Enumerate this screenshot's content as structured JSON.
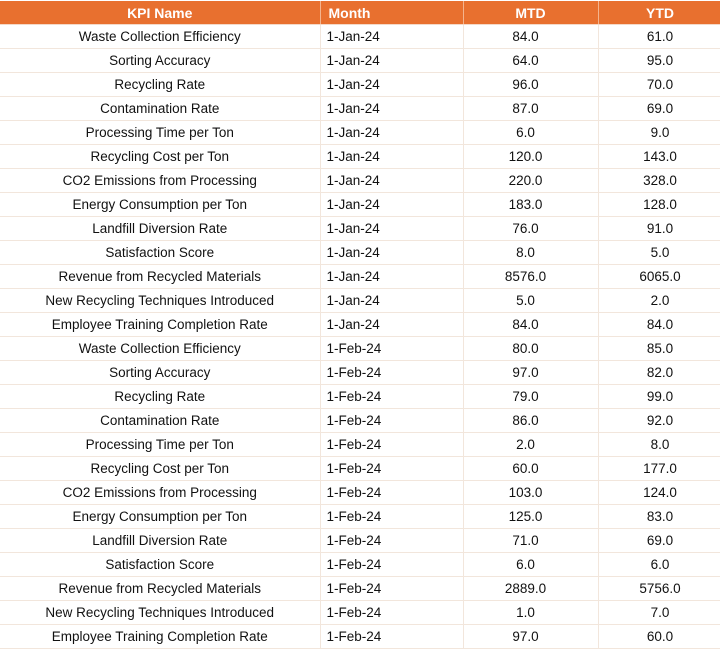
{
  "header": {
    "kpi": "KPI Name",
    "month": "Month",
    "mtd": "MTD",
    "ytd": "YTD"
  },
  "colors": {
    "header_bg": "#E8702F",
    "header_text": "#FFFFFF"
  },
  "rows": [
    {
      "kpi": "Waste Collection Efficiency",
      "month": "1-Jan-24",
      "mtd": "84.0",
      "ytd": "61.0"
    },
    {
      "kpi": "Sorting Accuracy",
      "month": "1-Jan-24",
      "mtd": "64.0",
      "ytd": "95.0"
    },
    {
      "kpi": "Recycling Rate",
      "month": "1-Jan-24",
      "mtd": "96.0",
      "ytd": "70.0"
    },
    {
      "kpi": "Contamination Rate",
      "month": "1-Jan-24",
      "mtd": "87.0",
      "ytd": "69.0"
    },
    {
      "kpi": "Processing Time per Ton",
      "month": "1-Jan-24",
      "mtd": "6.0",
      "ytd": "9.0"
    },
    {
      "kpi": "Recycling Cost per Ton",
      "month": "1-Jan-24",
      "mtd": "120.0",
      "ytd": "143.0"
    },
    {
      "kpi": "CO2 Emissions from Processing",
      "month": "1-Jan-24",
      "mtd": "220.0",
      "ytd": "328.0"
    },
    {
      "kpi": "Energy Consumption per Ton",
      "month": "1-Jan-24",
      "mtd": "183.0",
      "ytd": "128.0"
    },
    {
      "kpi": "Landfill Diversion Rate",
      "month": "1-Jan-24",
      "mtd": "76.0",
      "ytd": "91.0"
    },
    {
      "kpi": "Satisfaction Score",
      "month": "1-Jan-24",
      "mtd": "8.0",
      "ytd": "5.0"
    },
    {
      "kpi": "Revenue from Recycled Materials",
      "month": "1-Jan-24",
      "mtd": "8576.0",
      "ytd": "6065.0"
    },
    {
      "kpi": "New Recycling Techniques Introduced",
      "month": "1-Jan-24",
      "mtd": "5.0",
      "ytd": "2.0"
    },
    {
      "kpi": "Employee Training Completion Rate",
      "month": "1-Jan-24",
      "mtd": "84.0",
      "ytd": "84.0"
    },
    {
      "kpi": "Waste Collection Efficiency",
      "month": "1-Feb-24",
      "mtd": "80.0",
      "ytd": "85.0"
    },
    {
      "kpi": "Sorting Accuracy",
      "month": "1-Feb-24",
      "mtd": "97.0",
      "ytd": "82.0"
    },
    {
      "kpi": "Recycling Rate",
      "month": "1-Feb-24",
      "mtd": "79.0",
      "ytd": "99.0"
    },
    {
      "kpi": "Contamination Rate",
      "month": "1-Feb-24",
      "mtd": "86.0",
      "ytd": "92.0"
    },
    {
      "kpi": "Processing Time per Ton",
      "month": "1-Feb-24",
      "mtd": "2.0",
      "ytd": "8.0"
    },
    {
      "kpi": "Recycling Cost per Ton",
      "month": "1-Feb-24",
      "mtd": "60.0",
      "ytd": "177.0"
    },
    {
      "kpi": "CO2 Emissions from Processing",
      "month": "1-Feb-24",
      "mtd": "103.0",
      "ytd": "124.0"
    },
    {
      "kpi": "Energy Consumption per Ton",
      "month": "1-Feb-24",
      "mtd": "125.0",
      "ytd": "83.0"
    },
    {
      "kpi": "Landfill Diversion Rate",
      "month": "1-Feb-24",
      "mtd": "71.0",
      "ytd": "69.0"
    },
    {
      "kpi": "Satisfaction Score",
      "month": "1-Feb-24",
      "mtd": "6.0",
      "ytd": "6.0"
    },
    {
      "kpi": "Revenue from Recycled Materials",
      "month": "1-Feb-24",
      "mtd": "2889.0",
      "ytd": "5756.0"
    },
    {
      "kpi": "New Recycling Techniques Introduced",
      "month": "1-Feb-24",
      "mtd": "1.0",
      "ytd": "7.0"
    },
    {
      "kpi": "Employee Training Completion Rate",
      "month": "1-Feb-24",
      "mtd": "97.0",
      "ytd": "60.0"
    }
  ]
}
